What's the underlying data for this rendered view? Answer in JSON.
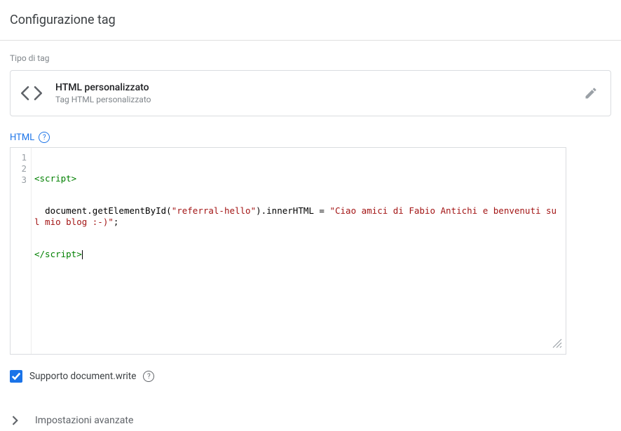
{
  "header": {
    "title": "Configurazione tag"
  },
  "tagType": {
    "sectionLabel": "Tipo di tag",
    "title": "HTML personalizzato",
    "subtitle": "Tag HTML personalizzato"
  },
  "editor": {
    "label": "HTML",
    "gutter": [
      "1",
      "2",
      "3"
    ],
    "line1_open": "<script>",
    "line2_pre": "  document.getElementById(",
    "line2_arg": "\"referral-hello\"",
    "line2_mid": ").innerHTML = ",
    "line2_str": "\"Ciao amici di Fabio Antichi e benvenuti sul mio blog :-)\"",
    "line2_end": ";",
    "line3_close": "</script>"
  },
  "options": {
    "documentWriteLabel": "Supporto document.write",
    "documentWriteChecked": true
  },
  "advanced": {
    "label": "Impostazioni avanzate"
  }
}
